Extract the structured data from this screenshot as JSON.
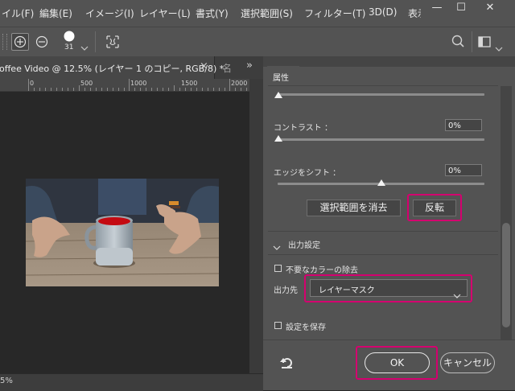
{
  "menubar": {
    "items": [
      "イル(F)",
      "編集(E)",
      "イメージ(I)",
      "レイヤー(L)",
      "書式(Y)",
      "選択範囲(S)",
      "フィルター(T)",
      "3D(D)",
      "表示"
    ],
    "minimize": "—",
    "maximize": "☐",
    "close": "✕"
  },
  "options": {
    "brush_size": "31"
  },
  "document_tab": {
    "title": "offee Video @ 12.5% (レイヤー 1 のコピー, RGB/8) *",
    "close": "×",
    "next_tab": "名",
    "overflow": "»"
  },
  "ruler": {
    "labels": [
      "0",
      "500",
      "1000",
      "1500",
      "2000"
    ]
  },
  "status": {
    "zoom": "5%"
  },
  "panel": {
    "title": "属性",
    "contrast_label": "コントラスト ：",
    "contrast_value": "0%",
    "edge_shift_label": "エッジをシフト ：",
    "edge_shift_value": "0%",
    "clear_selection_button": "選択範囲を消去",
    "invert_button": "反転",
    "output_section_title": "出力設定",
    "decontaminate_label": "不要なカラーの除去",
    "output_to_label": "出力先",
    "output_to_value": "レイヤーマスク",
    "remember_settings_label": "設定を保存",
    "ok_button": "OK",
    "cancel_button": "キャンセル"
  },
  "colors": {
    "highlight": "#d4006f",
    "panel_bg": "#535353",
    "dark_bg": "#282828",
    "cup_liquid": "#c40a12"
  }
}
